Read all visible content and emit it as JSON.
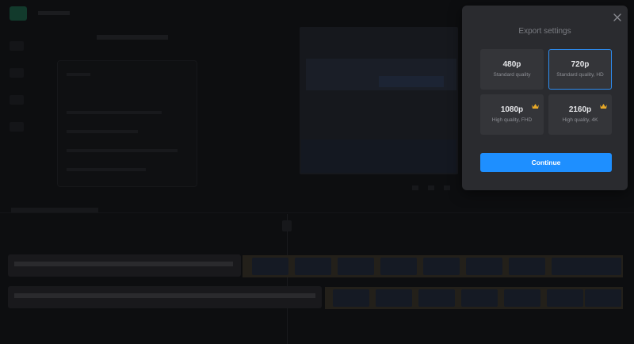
{
  "modal": {
    "title": "Export settings",
    "options": [
      {
        "resolution": "480p",
        "description": "Standard quality",
        "selected": false,
        "premium": false
      },
      {
        "resolution": "720p",
        "description": "Standard quality, HD",
        "selected": true,
        "premium": false
      },
      {
        "resolution": "1080p",
        "description": "High quality, FHD",
        "selected": false,
        "premium": true
      },
      {
        "resolution": "2160p",
        "description": "High quality, 4K",
        "selected": false,
        "premium": true
      }
    ],
    "continue_label": "Continue",
    "icons": {
      "close": "close-icon",
      "premium": "crown-icon"
    }
  },
  "colors": {
    "accent": "#1e8fff",
    "selected_border": "#2d8cf0",
    "modal_bg": "#2a2b2f",
    "option_bg": "#343539",
    "crown": "#e8a928"
  }
}
